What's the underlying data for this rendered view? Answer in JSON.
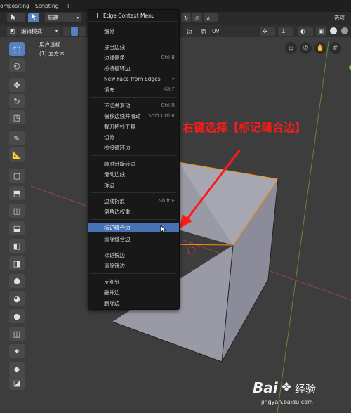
{
  "topbar": {
    "tabs": [
      "ompositing",
      "Scripting",
      "+"
    ]
  },
  "header1": {
    "new_label": "新建",
    "snap_icon": "mirror-icon"
  },
  "header2": {
    "mode_label": "编辑模式",
    "menus": [
      "边",
      "面",
      "UV"
    ],
    "right_label": "选项"
  },
  "viewport": {
    "persp_label": "用户透视",
    "object_label": "(1) 立方体"
  },
  "annotation": {
    "text": "右键选择【标记缝合边】",
    "color": "#ff1a1a"
  },
  "context_menu": {
    "title": "Edge Context Menu",
    "items": [
      {
        "label": "细分",
        "shortcut": ""
      },
      {
        "label": "挤出边线",
        "shortcut": ""
      },
      {
        "label": "边线倒角",
        "shortcut": "Ctrl B"
      },
      {
        "label": "桥接循环边",
        "shortcut": ""
      },
      {
        "label": "New Face from Edges",
        "shortcut": "F"
      },
      {
        "label": "填充",
        "shortcut": "Alt F"
      },
      {
        "label": "环切并滑动",
        "shortcut": "Ctrl R"
      },
      {
        "label": "偏移边线并滑动",
        "shortcut": "Shift Ctrl R"
      },
      {
        "label": "截刀拓扑工具",
        "shortcut": ""
      },
      {
        "label": "切分",
        "shortcut": ""
      },
      {
        "label": "桥接循环边",
        "shortcut": ""
      },
      {
        "label": "顺时针旋转边",
        "shortcut": ""
      },
      {
        "label": "滑动边线",
        "shortcut": ""
      },
      {
        "label": "拆边",
        "shortcut": ""
      },
      {
        "label": "边线折痕",
        "shortcut": "Shift E"
      },
      {
        "label": "倒角边权重",
        "shortcut": ""
      },
      {
        "label": "标记缝合边",
        "shortcut": ""
      },
      {
        "label": "清除缝合边",
        "shortcut": ""
      },
      {
        "label": "标记锐边",
        "shortcut": ""
      },
      {
        "label": "清除锐边",
        "shortcut": ""
      },
      {
        "label": "反细分",
        "shortcut": ""
      },
      {
        "label": "融并边",
        "shortcut": ""
      },
      {
        "label": "删除边",
        "shortcut": ""
      }
    ]
  },
  "watermark": {
    "brand": "Bai",
    "brand2": "经验",
    "url": "jingyan.baidu.com"
  },
  "colors": {
    "highlight": "#4772b3",
    "accent": "#5680c2",
    "edge_select": "#ff8c00"
  }
}
